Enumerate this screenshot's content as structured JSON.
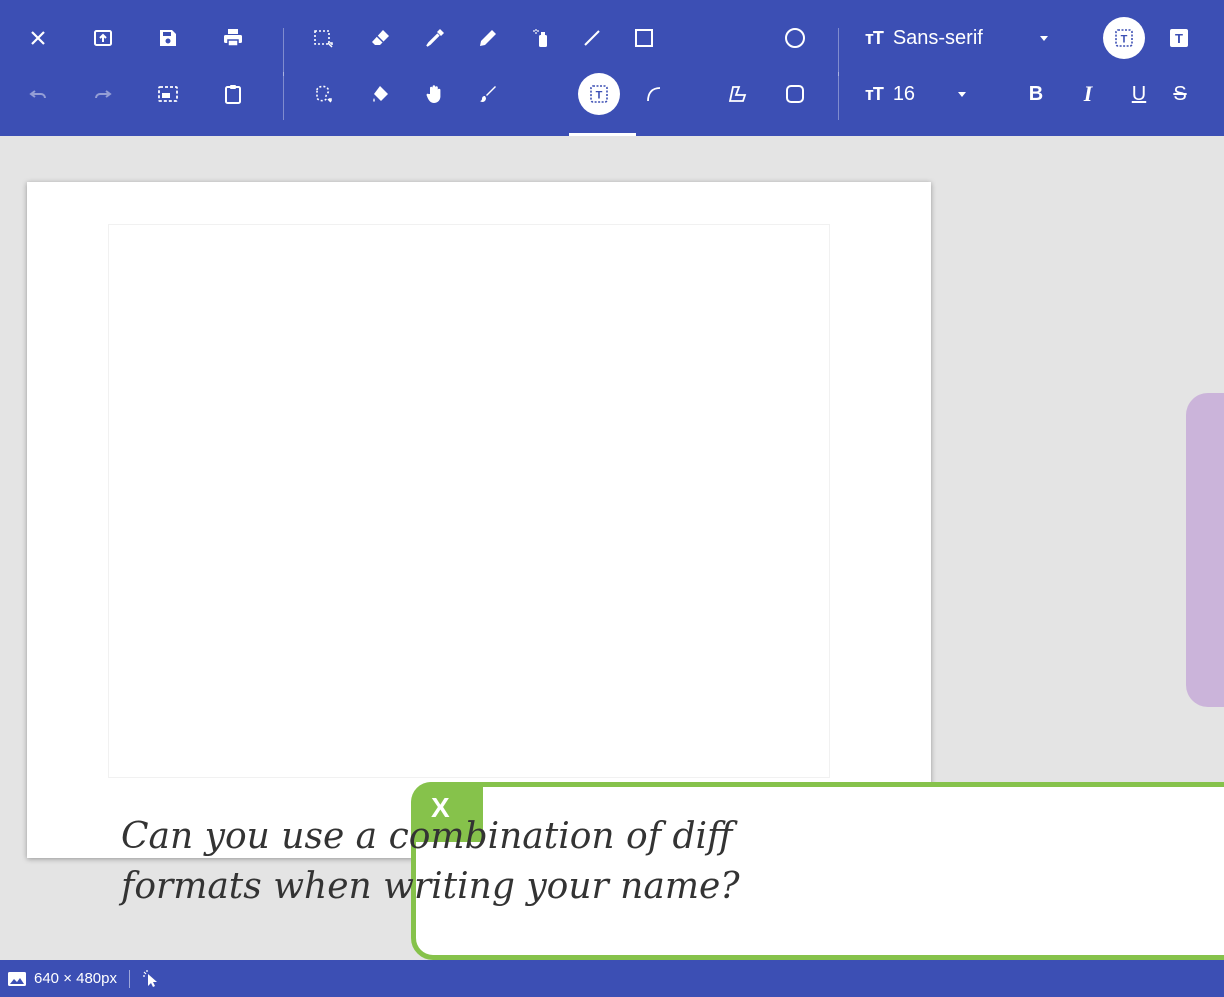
{
  "toolbar": {
    "font_family": "Sans-serif",
    "font_size": "16",
    "bold_label": "B",
    "italic_label": "I",
    "underline_label": "U",
    "strike_label": "S",
    "text_mode_label": "T",
    "active_tool": "text-tool",
    "accent_color": "#3c4fb4",
    "row1_icons": [
      "close-icon",
      "open-icon",
      "save-icon",
      "print-icon",
      "select-rect-icon",
      "eraser-icon",
      "color-picker-icon",
      "pencil-icon",
      "airbrush-icon",
      "line-icon",
      "rectangle-icon",
      "ellipse-icon",
      "font-size-icon",
      "text-background-icon"
    ],
    "row2_icons": [
      "undo-icon",
      "redo-icon",
      "crop-icon",
      "paste-icon",
      "select-free-icon",
      "fill-icon",
      "hand-icon",
      "brush-icon",
      "text-tool-icon",
      "curve-icon",
      "polygon-icon",
      "rounded-rect-icon",
      "font-size-icon"
    ]
  },
  "callout": {
    "close_label": "X",
    "line1": "Can you use a combination of diff",
    "line2": "formats when writing your name?",
    "border_color": "#86c24b"
  },
  "side_card": {
    "color": "#cbb4da"
  },
  "status": {
    "dimensions": "640 × 480px",
    "image_icon": "image-icon",
    "cursor_icon": "cursor-icon"
  }
}
